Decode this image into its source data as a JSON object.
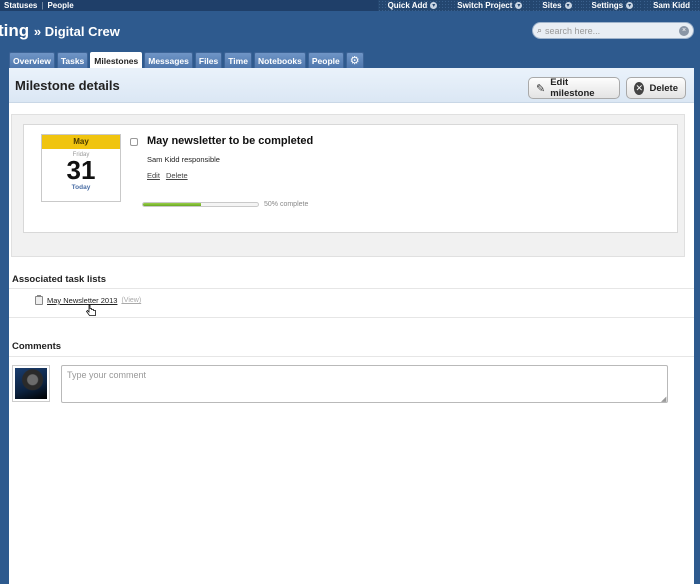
{
  "topbar": {
    "left_links": [
      "Statuses",
      "People"
    ],
    "menus": [
      "Quick Add",
      "Switch Project",
      "Sites",
      "Settings",
      "Sam Kidd"
    ]
  },
  "header": {
    "project_prefix": "ting",
    "project_sub": "» Digital Crew",
    "search_placeholder": "search here..."
  },
  "tabs": [
    "Overview",
    "Tasks",
    "Milestones",
    "Messages",
    "Files",
    "Time",
    "Notebooks",
    "People"
  ],
  "active_tab": "Milestones",
  "panel": {
    "title": "Milestone details",
    "edit_label": "Edit milestone",
    "delete_label": "Delete"
  },
  "milestone": {
    "cal_month": "May",
    "cal_weekday": "Friday",
    "cal_day": "31",
    "cal_relative": "Today",
    "title": "May newsletter to be completed",
    "responsible": "Sam Kidd responsible",
    "edit_link": "Edit",
    "delete_link": "Delete",
    "progress_percent": 50,
    "progress_label": "50% complete"
  },
  "task_lists": {
    "heading": "Associated task lists",
    "items": [
      {
        "name": "May Newsletter 2013",
        "view": "(View)"
      }
    ]
  },
  "comments": {
    "heading": "Comments",
    "placeholder": "Type your comment"
  }
}
